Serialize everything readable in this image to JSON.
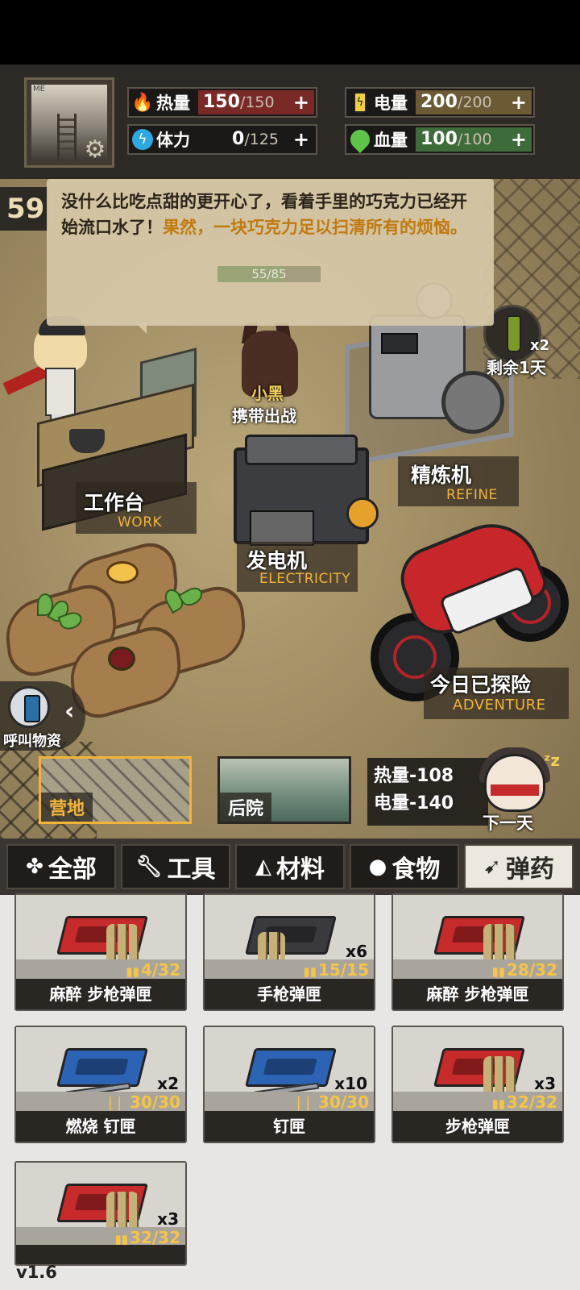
{
  "header": {
    "avatar_caption": "ME",
    "stats": [
      {
        "key": "heat",
        "label": "热量",
        "value": "150",
        "max": "/150",
        "plus": "+",
        "color": "#7a2a26",
        "icon": "flame-icon"
      },
      {
        "key": "power",
        "label": "电量",
        "value": "200",
        "max": "/200",
        "plus": "+",
        "color": "#6b5a34",
        "icon": "battery-icon"
      },
      {
        "key": "stamina",
        "label": "体力",
        "value": "0",
        "max": "/125",
        "plus": "+",
        "color": "#1b1917",
        "icon": "lightning-icon"
      },
      {
        "key": "health",
        "label": "血量",
        "value": "100",
        "max": "/100",
        "plus": "+",
        "color": "#3d6b3a",
        "icon": "health-drop-icon"
      }
    ]
  },
  "day": "59",
  "dialog": {
    "text_normal": "没什么比吃点甜的更开心了，看着手里的巧克力已经开始流口水了！",
    "text_highlight": "果然，一块巧克力足以扫清所有的烦恼。",
    "progress_text": "55/85",
    "progress_fraction": 0.647
  },
  "scene": {
    "dog_name": "小黑",
    "dog_action": "携带出战",
    "workbench_cn": "工作台",
    "workbench_en": "WORK",
    "generator_cn": "发电机",
    "generator_en": "ELECTRICITY",
    "refiner_cn": "精炼机",
    "refiner_en": "REFINE",
    "adventure_cn": "今日已探险",
    "adventure_en": "ADVENTURE",
    "oil_count": "x2",
    "oil_days": "剩余1天",
    "call_supplies": "呼叫物资"
  },
  "locations": {
    "camp": "营地",
    "backyard": "后院"
  },
  "summary": {
    "heat": "热量-108",
    "power": "电量-140",
    "next_day": "下一天"
  },
  "categories": [
    {
      "label": "全部",
      "icon": "clover-icon"
    },
    {
      "label": "工具",
      "icon": "wrench-icon"
    },
    {
      "label": "材料",
      "icon": "material-icon"
    },
    {
      "label": "食物",
      "icon": "drumstick-icon"
    },
    {
      "label": "弹药",
      "icon": "bullet-icon"
    }
  ],
  "inventory": [
    {
      "title": "麻醉 步枪弹匣",
      "ammo": "4/32",
      "count": ""
    },
    {
      "title": "手枪弹匣",
      "ammo": "15/15",
      "count": "x6"
    },
    {
      "title": "麻醉 步枪弹匣",
      "ammo": "28/32",
      "count": ""
    },
    {
      "title": "燃烧 钉匣",
      "ammo": "30/30",
      "count": "x2"
    },
    {
      "title": "钉匣",
      "ammo": "30/30",
      "count": "x10"
    },
    {
      "title": "步枪弹匣",
      "ammo": "32/32",
      "count": "x3"
    },
    {
      "title": "",
      "ammo": "32/32",
      "count": "x3"
    }
  ],
  "version": "v1.6"
}
